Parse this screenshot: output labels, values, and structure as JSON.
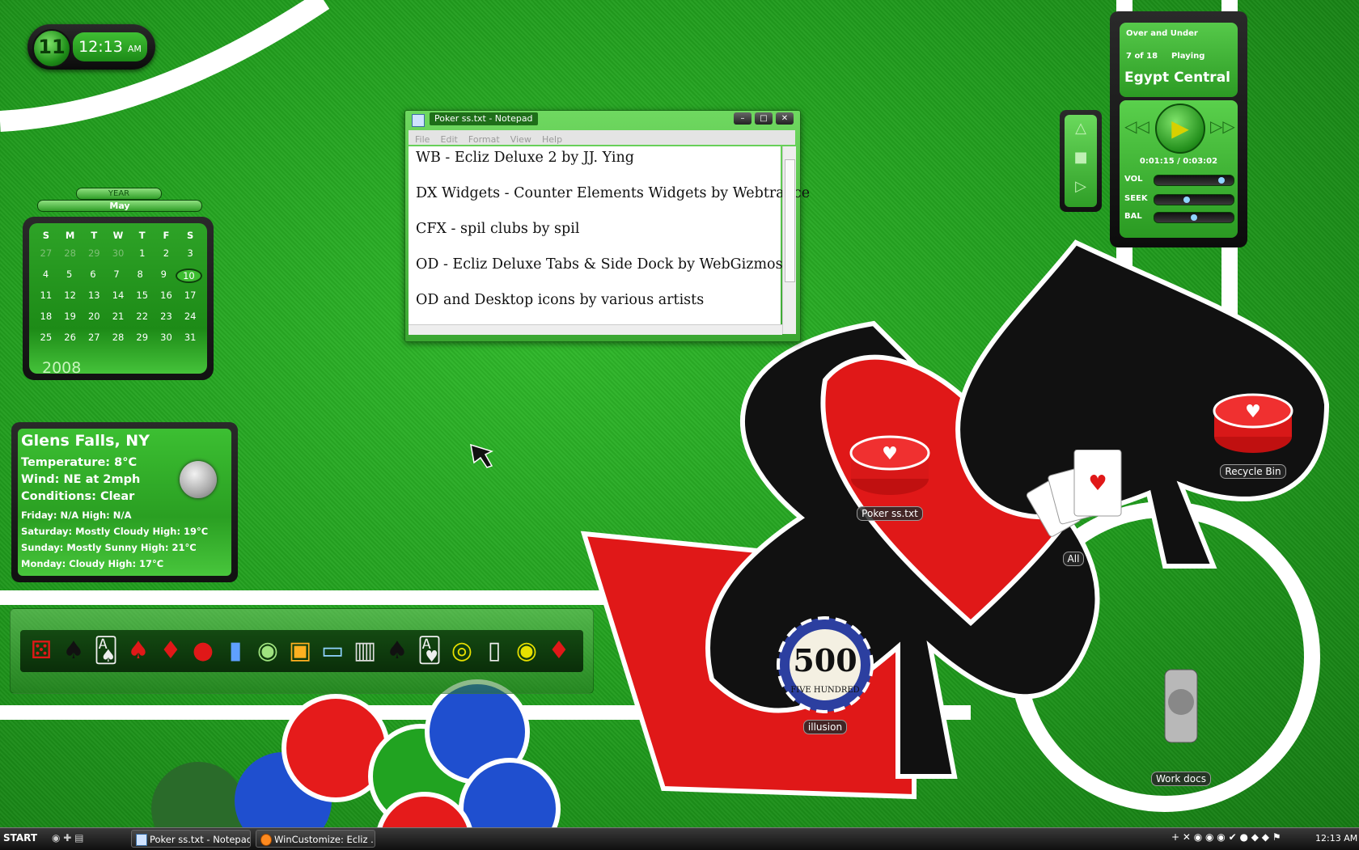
{
  "clock": {
    "hour_dial": "11",
    "time": "12:13",
    "ampm": "AM"
  },
  "calendar": {
    "year_tab": "YEAR",
    "month": "May",
    "weekdays": [
      "S",
      "M",
      "T",
      "W",
      "T",
      "F",
      "S"
    ],
    "weeks": [
      [
        "27",
        "28",
        "29",
        "30",
        "1",
        "2",
        "3"
      ],
      [
        "4",
        "5",
        "6",
        "7",
        "8",
        "9",
        "10"
      ],
      [
        "11",
        "12",
        "13",
        "14",
        "15",
        "16",
        "17"
      ],
      [
        "18",
        "19",
        "20",
        "21",
        "22",
        "23",
        "24"
      ],
      [
        "25",
        "26",
        "27",
        "28",
        "29",
        "30",
        "31"
      ]
    ],
    "today": "10",
    "year": "2008"
  },
  "weather": {
    "city": "Glens Falls, NY",
    "temperature": "Temperature: 8°C",
    "wind": "Wind: NE at 2mph",
    "conditions": "Conditions: Clear",
    "forecast": [
      "Friday: N/A High: N/A",
      "Saturday: Mostly Cloudy High: 19°C",
      "Sunday: Mostly Sunny High: 21°C",
      "Monday: Cloudy High: 17°C"
    ]
  },
  "notepad": {
    "title": "Poker ss.txt - Notepad",
    "menu": [
      "File",
      "Edit",
      "Format",
      "View",
      "Help"
    ],
    "lines": [
      "WB - Ecliz Deluxe 2 by JJ. Ying",
      "DX Widgets - Counter Elements Widgets by Webtrance",
      "CFX - spil clubs by spil",
      "OD -  Ecliz Deluxe Tabs & Side Dock by WebGizmos",
      "OD and Desktop icons by various artists"
    ]
  },
  "player": {
    "song": "Over and Under",
    "track_pos": "7 of 18",
    "status": "Playing",
    "artist": "Egypt Central",
    "time": "0:01:15 / 0:03:02",
    "sliders": [
      {
        "label": "VOL",
        "value": 0.9
      },
      {
        "label": "SEEK",
        "value": 0.4
      },
      {
        "label": "BAL",
        "value": 0.5
      }
    ]
  },
  "desktop_icons": {
    "poker": "Poker ss.txt",
    "recycle": "Recycle Bin",
    "all": "All",
    "illusion": "illusion",
    "work": "Work docs",
    "chip_value": "500",
    "chip_text": "FIVE HUNDRED"
  },
  "taskbar": {
    "start": "START",
    "tasks": [
      "Poker ss.txt - Notepad",
      "WinCustomize: Ecliz ..."
    ],
    "clock": "12:13 AM"
  },
  "colors": {
    "felt": "#1f9a1c",
    "accent": "#3cbf32",
    "red": "#e01818"
  }
}
